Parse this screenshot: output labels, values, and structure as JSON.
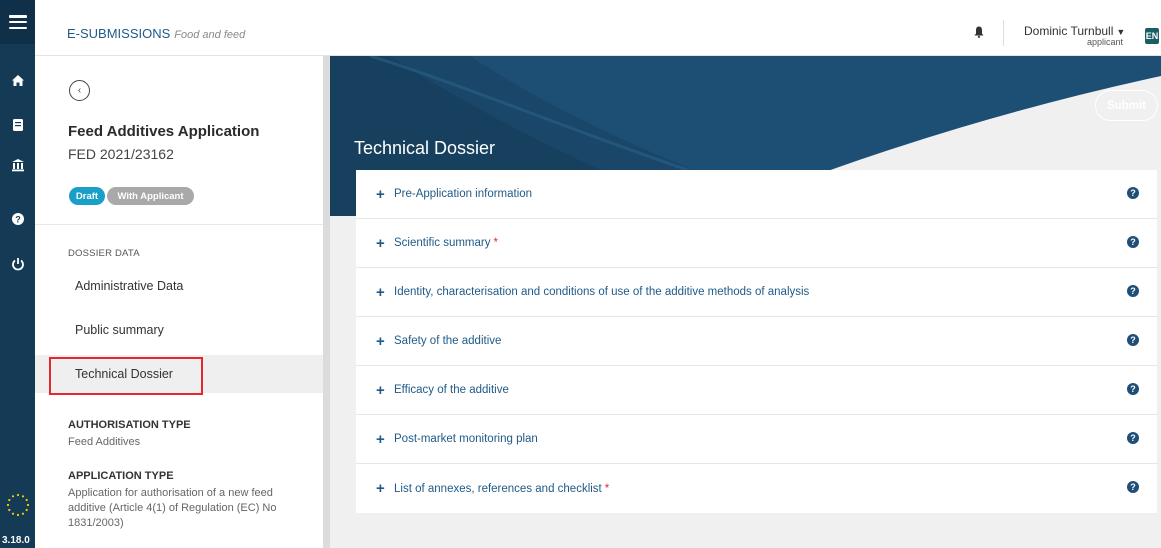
{
  "header": {
    "brand": "E-SUBMISSIONS",
    "brand_sub": "Food and feed",
    "user_name": "Dominic Turnbull",
    "user_role": "applicant",
    "language": "EN"
  },
  "rail": {
    "icons": [
      "menu-icon",
      "home-icon",
      "document-icon",
      "bank-icon",
      "help-icon",
      "power-icon"
    ],
    "version": "3.18.0"
  },
  "panel": {
    "back_icon": "‹",
    "title": "Feed Additives Application",
    "reference": "FED 2021/23162",
    "badges": [
      "Draft",
      "With Applicant"
    ],
    "section_label": "DOSSIER DATA",
    "nav": [
      "Administrative Data",
      "Public summary",
      "Technical Dossier"
    ],
    "authorisation_type_label": "AUTHORISATION TYPE",
    "authorisation_type_value": "Feed Additives",
    "application_type_label": "APPLICATION TYPE",
    "application_type_value": "Application for authorisation of a new feed additive (Article 4(1) of Regulation (EC) No 1831/2003)"
  },
  "main": {
    "title": "Technical Dossier",
    "submit_label": "Submit",
    "sections": [
      {
        "label": "Pre-Application information",
        "required": ""
      },
      {
        "label": "Scientific summary",
        "required": "*"
      },
      {
        "label": "Identity, characterisation and conditions of use of the additive methods of analysis",
        "required": ""
      },
      {
        "label": "Safety of the additive",
        "required": ""
      },
      {
        "label": "Efficacy of the additive",
        "required": ""
      },
      {
        "label": "Post-market monitoring plan",
        "required": ""
      },
      {
        "label": "List of annexes, references and checklist",
        "required": "*"
      }
    ]
  },
  "colors": {
    "rail": "#143a56",
    "hero": "#1d4e73",
    "accent": "#1f5a88",
    "required": "#e4282e",
    "draft_badge": "#1aa0c8",
    "applicant_badge": "#a9a9a9"
  }
}
